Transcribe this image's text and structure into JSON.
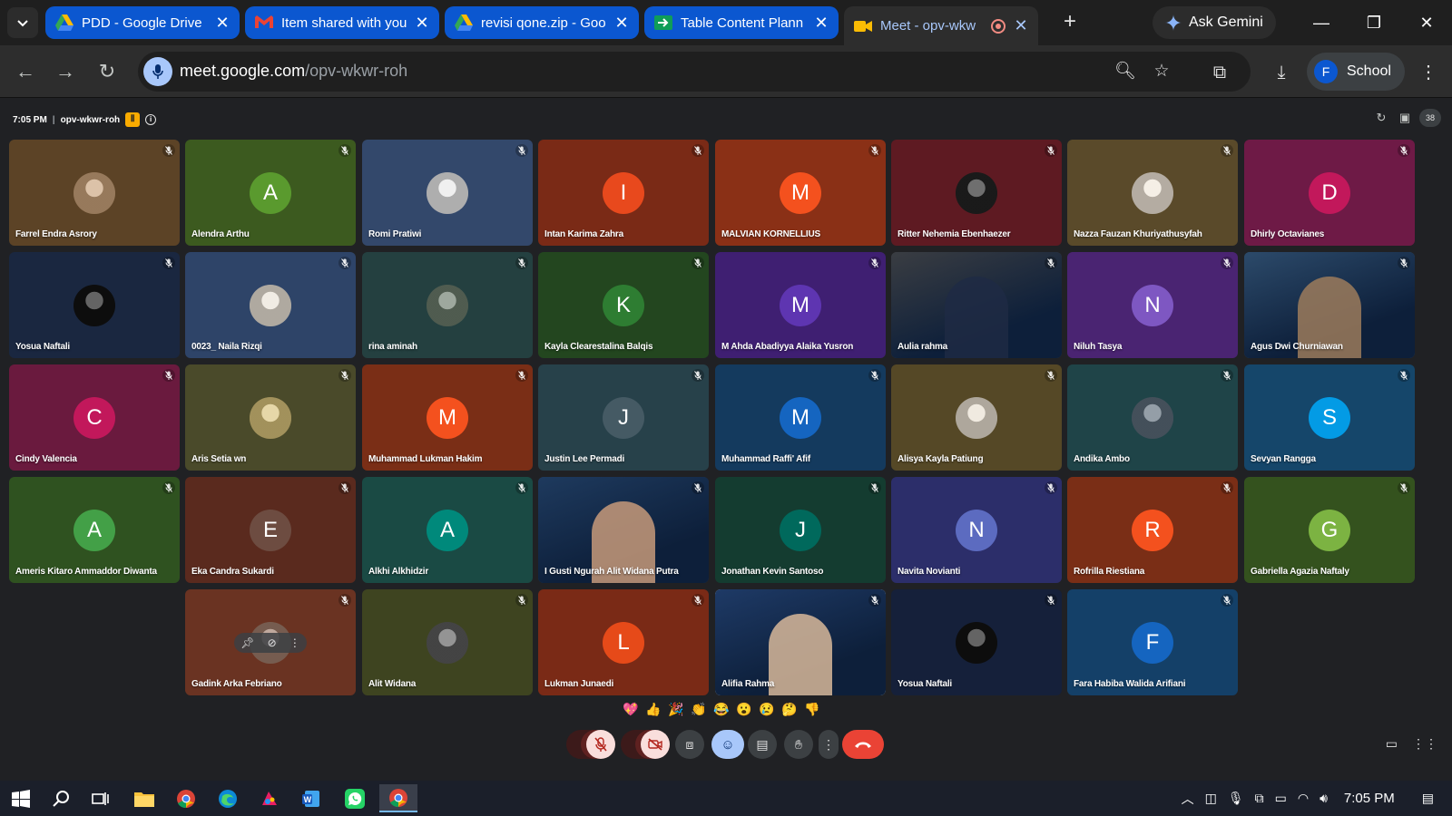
{
  "browser": {
    "tabs": [
      {
        "title": "PDD - Google Drive",
        "icon": "google-drive-icon",
        "active": false
      },
      {
        "title": "Item shared with you",
        "icon": "gmail-icon",
        "active": false
      },
      {
        "title": "revisi qone.zip - Goo",
        "icon": "google-drive-icon",
        "active": false
      },
      {
        "title": "Table Content Plann",
        "icon": "google-sheets-icon",
        "active": false
      },
      {
        "title": "Meet - opv-wkw",
        "icon": "google-meet-icon",
        "active": true
      }
    ],
    "new_tab_label": "+",
    "gemini_label": "Ask Gemini",
    "url_host": "meet.google.com",
    "url_path": "/opv-wkwr-roh",
    "profile_initial": "F",
    "profile_label": "School"
  },
  "meet": {
    "time": "7:05 PM",
    "meeting_code": "opv-wkwr-roh",
    "participant_count": "38",
    "tiles": [
      {
        "name": "Farrel Endra Asrory",
        "type": "photo",
        "bg": "#5c4326",
        "avatar_color": "#c9a27a"
      },
      {
        "name": "Alendra Arthu",
        "type": "initial",
        "initial": "A",
        "bg": "#3c5a1f",
        "avatar_color": "#5a9a2e"
      },
      {
        "name": "Romi Pratiwi",
        "type": "photo",
        "bg": "#33486b",
        "avatar_color": "#e8e8e8"
      },
      {
        "name": "Intan Karima Zahra",
        "type": "initial",
        "initial": "I",
        "bg": "#7a2a16",
        "avatar_color": "#e8491d"
      },
      {
        "name": "MALVIAN KORNELLIUS",
        "type": "initial",
        "initial": "M",
        "bg": "#8a3016",
        "avatar_color": "#f4511e"
      },
      {
        "name": "Ritter Nehemia Ebenhaezer",
        "type": "photo",
        "bg": "#5e1a22",
        "avatar_color": "#222"
      },
      {
        "name": "Nazza Fauzan Khuriyathusyfah",
        "type": "photo",
        "bg": "#5a4a2a",
        "avatar_color": "#f0e6d8"
      },
      {
        "name": "Dhirly Octavianes",
        "type": "initial",
        "initial": "D",
        "bg": "#6e1a46",
        "avatar_color": "#c2185b"
      },
      {
        "name": "Yosua Naftali",
        "type": "photo",
        "bg": "#1a2740",
        "avatar_color": "#111"
      },
      {
        "name": "0023_ Naila Rizqi",
        "type": "photo",
        "bg": "#2e4468",
        "avatar_color": "#e9e2d6"
      },
      {
        "name": "rina aminah",
        "type": "photo",
        "bg": "#244040",
        "avatar_color": "#6a7a6a"
      },
      {
        "name": "Kayla Clearestalina Balqis",
        "type": "initial",
        "initial": "K",
        "bg": "#23461f",
        "avatar_color": "#2e7d32"
      },
      {
        "name": "M Ahda Abadiyya Alaika Yusron",
        "type": "initial",
        "initial": "M",
        "bg": "#3f1f72",
        "avatar_color": "#5e35b1"
      },
      {
        "name": "Aulia rahma",
        "type": "video",
        "bg": "#3a3d42",
        "avatar_color": "#1e2a44"
      },
      {
        "name": "Niluh Tasya",
        "type": "initial",
        "initial": "N",
        "bg": "#4a2472",
        "avatar_color": "#7e57c2"
      },
      {
        "name": "Agus Dwi Churniawan",
        "type": "video",
        "bg": "#2c4a6a",
        "avatar_color": "#9c7b5c"
      },
      {
        "name": "Cindy Valencia",
        "type": "initial",
        "initial": "C",
        "bg": "#6a1a3e",
        "avatar_color": "#c2185b"
      },
      {
        "name": "Aris Setia wn",
        "type": "photo",
        "bg": "#4a4a2a",
        "avatar_color": "#d8c27a"
      },
      {
        "name": "Muhammad Lukman Hakim",
        "type": "initial",
        "initial": "M",
        "bg": "#7a2e16",
        "avatar_color": "#f4511e"
      },
      {
        "name": "Justin Lee Permadi",
        "type": "initial",
        "initial": "J",
        "bg": "#27414a",
        "avatar_color": "#455a64"
      },
      {
        "name": "Muhammad Raffi' Afif",
        "type": "initial",
        "initial": "M",
        "bg": "#143a5e",
        "avatar_color": "#1565c0"
      },
      {
        "name": "Alisya Kayla Patiung",
        "type": "photo",
        "bg": "#554826",
        "avatar_color": "#e8dfd0"
      },
      {
        "name": "Andika Ambo",
        "type": "photo",
        "bg": "#1f4448",
        "avatar_color": "#5a6a78"
      },
      {
        "name": "Sevyan Rangga",
        "type": "initial",
        "initial": "S",
        "bg": "#15466a",
        "avatar_color": "#039be5"
      },
      {
        "name": "Ameris Kitaro Ammaddor Diwanta",
        "type": "initial",
        "initial": "A",
        "bg": "#2f5220",
        "avatar_color": "#43a047"
      },
      {
        "name": "Eka Candra Sukardi",
        "type": "initial",
        "initial": "E",
        "bg": "#5a2a1e",
        "avatar_color": "#6d4c41"
      },
      {
        "name": "Alkhi Alkhidzir",
        "type": "initial",
        "initial": "A",
        "bg": "#1a4a44",
        "avatar_color": "#00897b"
      },
      {
        "name": "I Gusti Ngurah Alit Widana Putra",
        "type": "video",
        "bg": "#1e3a5e",
        "avatar_color": "#c79a7a"
      },
      {
        "name": "Jonathan Kevin Santoso",
        "type": "initial",
        "initial": "J",
        "bg": "#143c30",
        "avatar_color": "#00695c"
      },
      {
        "name": "Navita Novianti",
        "type": "initial",
        "initial": "N",
        "bg": "#2c2e6a",
        "avatar_color": "#5c6bc0"
      },
      {
        "name": "Rofrilla Riestiana",
        "type": "initial",
        "initial": "R",
        "bg": "#7a2e16",
        "avatar_color": "#f4511e"
      },
      {
        "name": "Gabriella Agazia Naftaly",
        "type": "initial",
        "initial": "G",
        "bg": "#34521e",
        "avatar_color": "#7cb342"
      },
      {
        "name": "Gadink Arka Febriano",
        "type": "hover",
        "bg": "#6a3322",
        "avatar_color": "#9e7b6a"
      },
      {
        "name": "Alit Widana",
        "type": "photo",
        "bg": "#3e4420",
        "avatar_color": "#5a5a5a"
      },
      {
        "name": "Lukman Junaedi",
        "type": "initial",
        "initial": "L",
        "bg": "#7a2a16",
        "avatar_color": "#e64a19"
      },
      {
        "name": "Alifia Rahma",
        "type": "video",
        "bg": "#1e3a66",
        "avatar_color": "#d8b89a"
      },
      {
        "name": "Yosua Naftali",
        "type": "photo",
        "bg": "#15203a",
        "avatar_color": "#111"
      },
      {
        "name": "Fara Habiba Walida Arifiani",
        "type": "initial",
        "initial": "F",
        "bg": "#144068",
        "avatar_color": "#1565c0"
      }
    ],
    "reactions": [
      "💖",
      "👍",
      "🎉",
      "👏",
      "😂",
      "😮",
      "😢",
      "🤔",
      "👎"
    ],
    "taskbar_time": "7:05 PM"
  }
}
